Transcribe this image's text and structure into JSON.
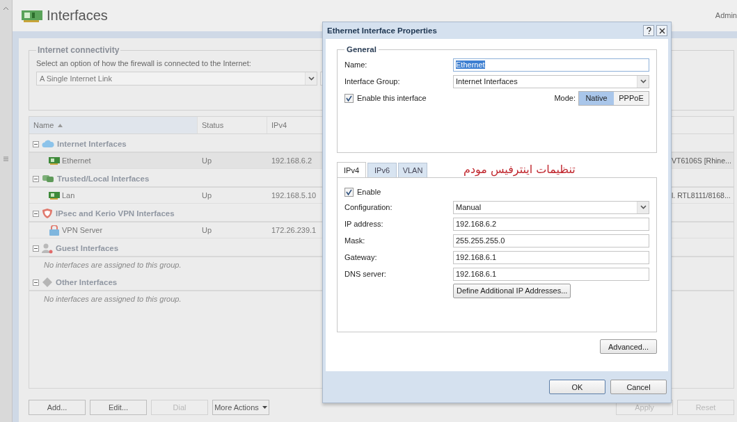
{
  "page": {
    "title": "Interfaces",
    "user": "Admin"
  },
  "connectivity": {
    "legend": "Internet connectivity",
    "prompt": "Select an option of how the firewall is connected to the Internet:",
    "value": "A Single Internet Link"
  },
  "table": {
    "columns": [
      {
        "label": "Name",
        "sorted": true
      },
      {
        "label": "Status",
        "sorted": false
      },
      {
        "label": "IPv4",
        "sorted": false
      }
    ],
    "groups": [
      {
        "name": "Internet Interfaces",
        "kind": "internet",
        "expanded": true,
        "rows": [
          {
            "name": "Ethernet",
            "kind": "nic",
            "status": "Up",
            "ipv4": "192.168.6.2",
            "column_4": "VT6106S [Rhine...",
            "selected": true
          }
        ]
      },
      {
        "name": "Trusted/Local Interfaces",
        "kind": "trusted",
        "expanded": true,
        "rows": [
          {
            "name": "Lan",
            "kind": "nic",
            "status": "Up",
            "ipv4": "192.168.5.10",
            "column_4": "l. RTL8111/8168...",
            "selected": false
          }
        ]
      },
      {
        "name": "IPsec and Kerio VPN Interfaces",
        "kind": "vpn",
        "expanded": true,
        "rows": [
          {
            "name": "VPN Server",
            "kind": "vpn",
            "status": "Up",
            "ipv4": "172.26.239.1",
            "selected": false
          }
        ]
      },
      {
        "name": "Guest Interfaces",
        "kind": "guest",
        "expanded": true,
        "empty_text": "No interfaces are assigned to this group."
      },
      {
        "name": "Other Interfaces",
        "kind": "other",
        "expanded": true,
        "empty_text": "No interfaces are assigned to this group."
      }
    ]
  },
  "toolbar": [
    {
      "label": "Add...",
      "kind": "plain",
      "disabled": false
    },
    {
      "label": "Edit...",
      "kind": "plain",
      "disabled": false
    },
    {
      "label": "Dial",
      "kind": "plain",
      "disabled": true
    },
    {
      "label": "More Actions",
      "kind": "menu",
      "disabled": false
    }
  ],
  "footer_buttons": [
    {
      "label": "Apply",
      "disabled": true
    },
    {
      "label": "Reset",
      "disabled": true
    }
  ],
  "dialog": {
    "title": "Ethernet Interface Properties",
    "general": {
      "legend": "General",
      "fields": [
        {
          "label": "Name:",
          "kind": "text",
          "value": "Ethernet",
          "value_selected": true
        },
        {
          "label": "Interface Group:",
          "kind": "select",
          "value": "Internet Interfaces",
          "value_selected": false
        }
      ],
      "enable": {
        "label": "Enable this interface",
        "checked": true
      },
      "mode_label": "Mode:",
      "modes": [
        {
          "label": "Native",
          "selected": true
        },
        {
          "label": "PPPoE",
          "selected": false
        }
      ]
    },
    "tabs": [
      {
        "label": "IPv4",
        "selected": true
      },
      {
        "label": "IPv6",
        "selected": false
      },
      {
        "label": "VLAN",
        "selected": false
      }
    ],
    "annotation": "تنظیمات اینترفیس مودم",
    "ipv4": {
      "enable": {
        "label": "Enable",
        "checked": true
      },
      "fields": [
        {
          "label": "Configuration:",
          "kind": "select",
          "value": "Manual"
        },
        {
          "label": "IP address:",
          "kind": "text",
          "value": "192.168.6.2"
        },
        {
          "label": "Mask:",
          "kind": "text",
          "value": "255.255.255.0"
        },
        {
          "label": "Gateway:",
          "kind": "text",
          "value": "192.168.6.1"
        },
        {
          "label": "DNS server:",
          "kind": "text",
          "value": "192.168.6.1"
        }
      ],
      "extra_button": "Define Additional IP Addresses..."
    },
    "advanced_button": "Advanced...",
    "buttons": [
      {
        "label": "OK",
        "kind": "primary"
      },
      {
        "label": "Cancel",
        "kind": "secondary"
      }
    ]
  }
}
